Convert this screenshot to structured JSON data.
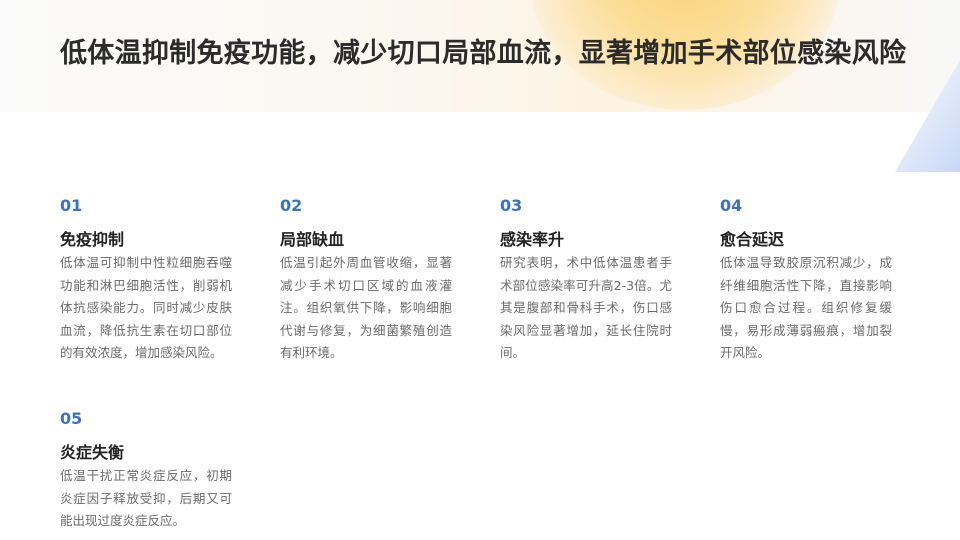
{
  "title": "低体温抑制免疫功能，减少切口局部血流，显著增加手术部位感染风险",
  "items": [
    {
      "number": "01",
      "heading": "免疫抑制",
      "text": "低体温可抑制中性粒细胞吞噬功能和淋巴细胞活性，削弱机体抗感染能力。同时减少皮肤血流，降低抗生素在切口部位的有效浓度，增加感染风险。"
    },
    {
      "number": "02",
      "heading": "局部缺血",
      "text": "低温引起外周血管收缩，显著减少手术切口区域的血液灌注。组织氧供下降，影响细胞代谢与修复，为细菌繁殖创造有利环境。"
    },
    {
      "number": "03",
      "heading": "感染率升",
      "text": "研究表明，术中低体温患者手术部位感染率可升高2-3倍。尤其是腹部和骨科手术，伤口感染风险显著增加，延长住院时间。"
    },
    {
      "number": "04",
      "heading": "愈合延迟",
      "text": "低体温导致胶原沉积减少，成纤维细胞活性下降，直接影响伤口愈合过程。组织修复缓慢，易形成薄弱瘢痕，增加裂开风险。"
    },
    {
      "number": "05",
      "heading": "炎症失衡",
      "text": "低温干扰正常炎症反应，初期炎症因子释放受抑，后期又可能出现过度炎症反应。"
    }
  ]
}
